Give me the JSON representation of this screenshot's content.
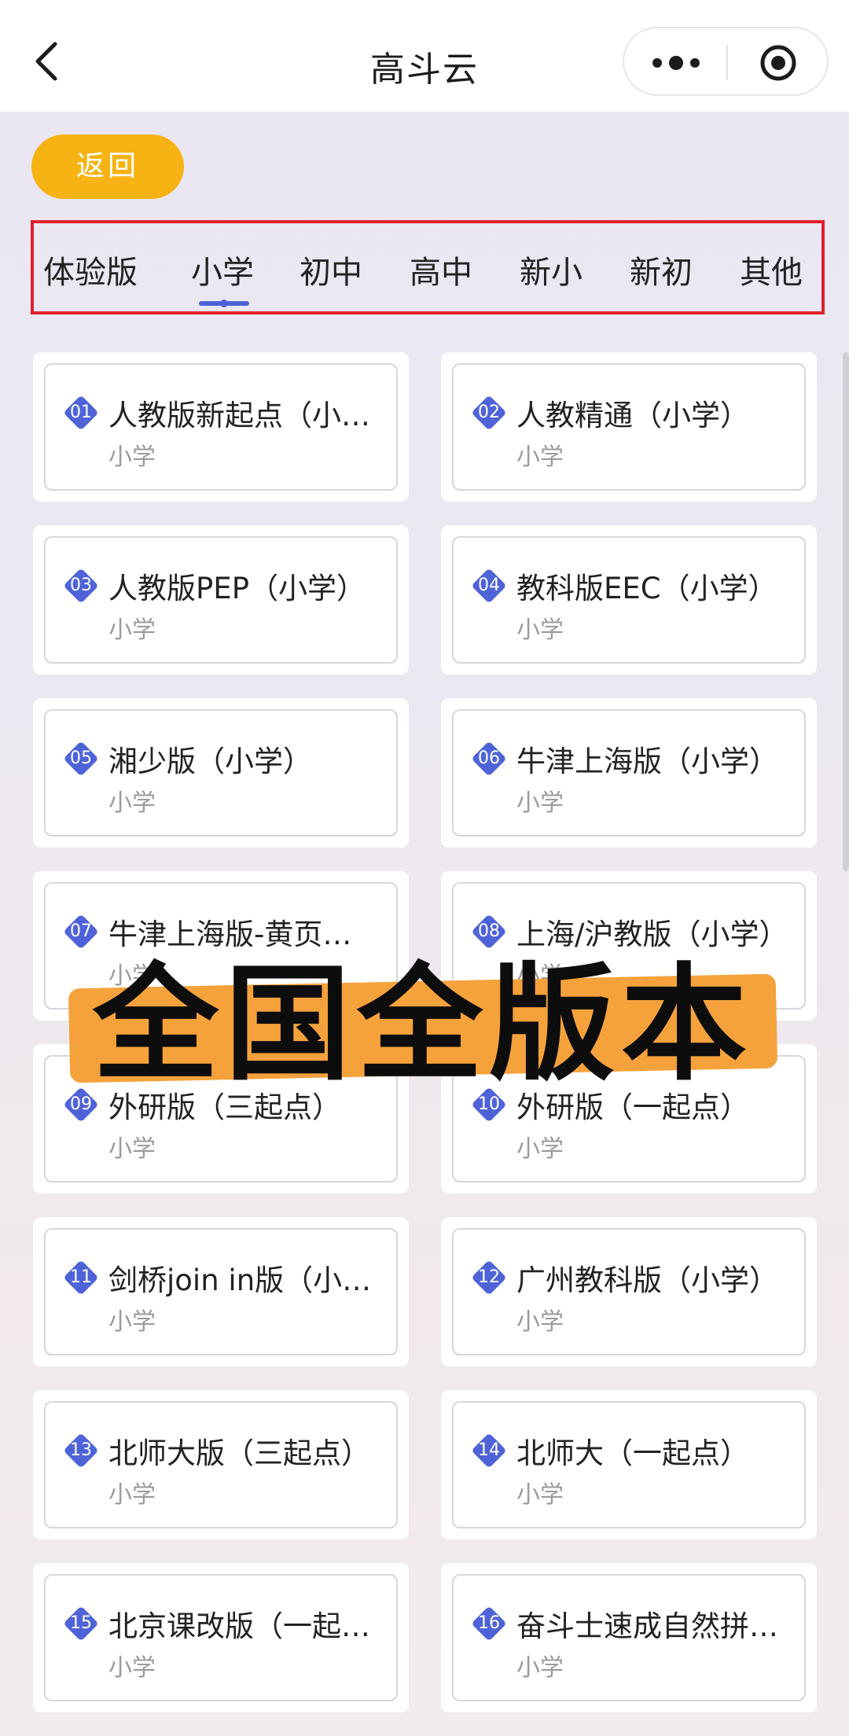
{
  "app": {
    "title": "高斗云",
    "back_label": "返回"
  },
  "icons": {
    "back": "chevron-left-icon",
    "more": "more-dots-icon",
    "close": "target-circle-icon"
  },
  "colors": {
    "accent_orange": "#f7b314",
    "badge_blue": "#4f63d8",
    "tab_indicator": "#4f63d8",
    "frame_red": "#e0202a",
    "overlay_orange": "#f5a23c"
  },
  "tabs": [
    {
      "label": "体验版",
      "selected": false
    },
    {
      "label": "小学",
      "selected": true
    },
    {
      "label": "初中",
      "selected": false
    },
    {
      "label": "高中",
      "selected": false
    },
    {
      "label": "新小",
      "selected": false
    },
    {
      "label": "新初",
      "selected": false
    },
    {
      "label": "其他",
      "selected": false
    }
  ],
  "cards": [
    {
      "num": "01",
      "title": "人教版新起点（小…",
      "sub": "小学"
    },
    {
      "num": "02",
      "title": "人教精通（小学）",
      "sub": "小学"
    },
    {
      "num": "03",
      "title": "人教版PEP（小学）",
      "sub": "小学"
    },
    {
      "num": "04",
      "title": "教科版EEC（小学）",
      "sub": "小学"
    },
    {
      "num": "05",
      "title": "湘少版（小学）",
      "sub": "小学"
    },
    {
      "num": "06",
      "title": "牛津上海版（小学）",
      "sub": "小学"
    },
    {
      "num": "07",
      "title": "牛津上海版-黄页…",
      "sub": "小学"
    },
    {
      "num": "08",
      "title": "上海/沪教版（小学）",
      "sub": "小学"
    },
    {
      "num": "09",
      "title": "外研版（三起点）",
      "sub": "小学"
    },
    {
      "num": "10",
      "title": "外研版（一起点）",
      "sub": "小学"
    },
    {
      "num": "11",
      "title": "剑桥join in版（小…",
      "sub": "小学"
    },
    {
      "num": "12",
      "title": "广州教科版（小学）",
      "sub": "小学"
    },
    {
      "num": "13",
      "title": "北师大版（三起点）",
      "sub": "小学"
    },
    {
      "num": "14",
      "title": "北师大（一起点）",
      "sub": "小学"
    },
    {
      "num": "15",
      "title": "北京课改版（一起…",
      "sub": "小学"
    },
    {
      "num": "16",
      "title": "奋斗士速成自然拼…",
      "sub": "小学"
    }
  ],
  "overlay": {
    "text": "全国全版本"
  }
}
